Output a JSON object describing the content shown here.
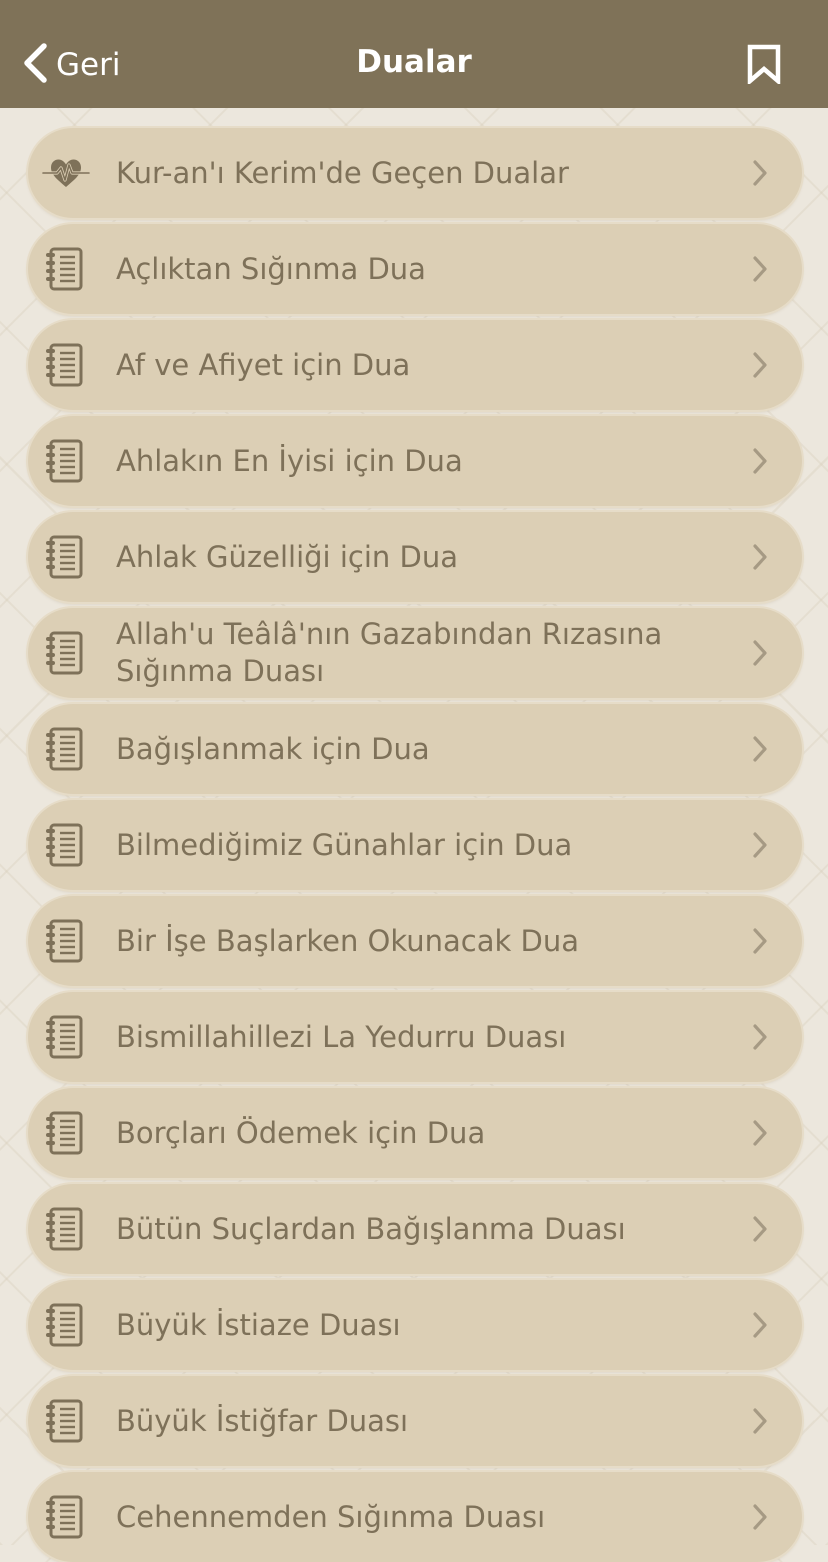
{
  "header": {
    "back_label": "Geri",
    "title": "Dualar",
    "bookmark_icon": "bookmark-icon",
    "background_color": "#7f7258"
  },
  "list": {
    "items": [
      {
        "label": "Kur-an'ı Kerim'de Geçen Dualar",
        "icon": "heartbeat-icon"
      },
      {
        "label": "Açlıktan Sığınma Dua",
        "icon": "notebook-icon"
      },
      {
        "label": "Af ve Afiyet için Dua",
        "icon": "notebook-icon"
      },
      {
        "label": "Ahlakın En İyisi için Dua",
        "icon": "notebook-icon"
      },
      {
        "label": "Ahlak Güzelliği için Dua",
        "icon": "notebook-icon"
      },
      {
        "label": "Allah'u Teâlâ'nın Gazabından Rızasına Sığınma Duası",
        "icon": "notebook-icon"
      },
      {
        "label": "Bağışlanmak için Dua",
        "icon": "notebook-icon"
      },
      {
        "label": "Bilmediğimiz Günahlar için Dua",
        "icon": "notebook-icon"
      },
      {
        "label": "Bir İşe Başlarken Okunacak Dua",
        "icon": "notebook-icon"
      },
      {
        "label": "Bismillahillezi La Yedurru Duası",
        "icon": "notebook-icon"
      },
      {
        "label": "Borçları Ödemek için Dua",
        "icon": "notebook-icon"
      },
      {
        "label": "Bütün Suçlardan Bağışlanma Duası",
        "icon": "notebook-icon"
      },
      {
        "label": "Büyük İstiaze Duası",
        "icon": "notebook-icon"
      },
      {
        "label": "Büyük İstiğfar Duası",
        "icon": "notebook-icon"
      },
      {
        "label": "Cehennemden Sığınma Duası",
        "icon": "notebook-icon"
      }
    ],
    "row_color": "#dccfb5",
    "text_color": "#7e7159"
  }
}
